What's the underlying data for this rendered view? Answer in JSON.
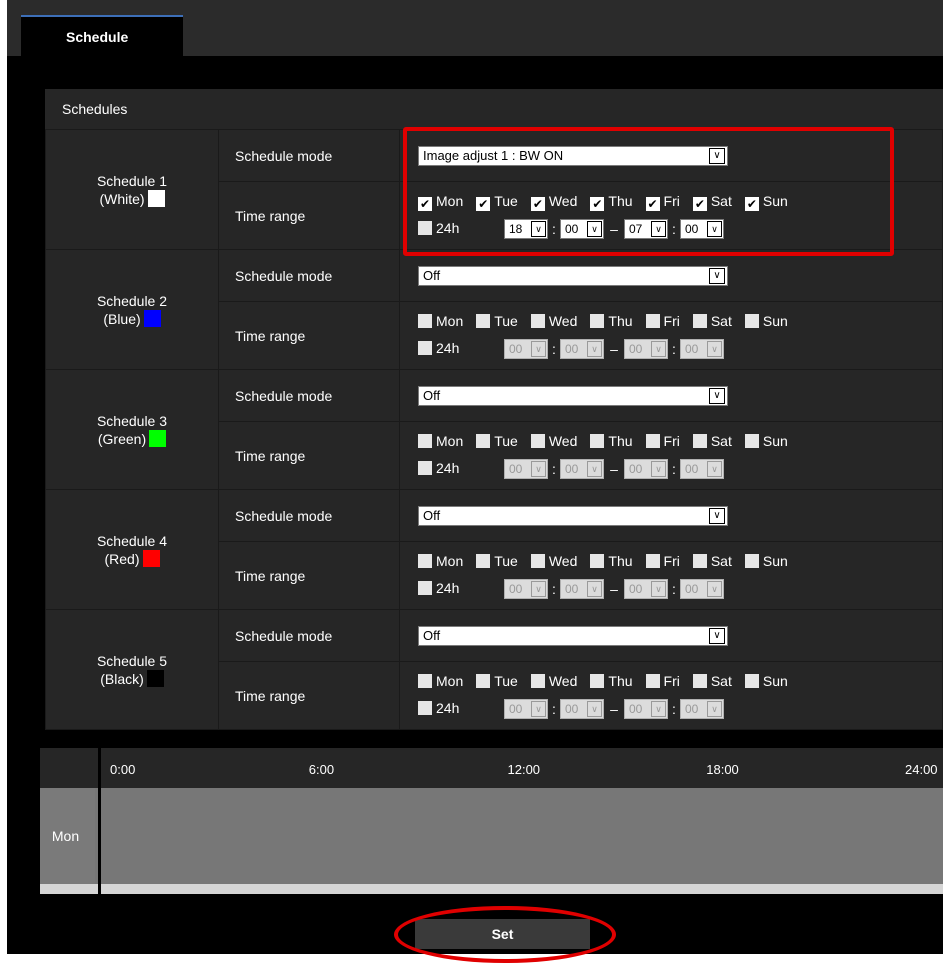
{
  "tab": {
    "label": "Schedule"
  },
  "section_title": "Schedules",
  "row_labels": {
    "mode": "Schedule mode",
    "range": "Time range"
  },
  "day_labels": [
    "Mon",
    "Tue",
    "Wed",
    "Thu",
    "Fri",
    "Sat",
    "Sun"
  ],
  "label_24h": "24h",
  "dash": "–",
  "colon": ":",
  "schedules": [
    {
      "title": "Schedule 1",
      "color_name": "(White)",
      "color": "#ffffff",
      "mode": "Image adjust 1 : BW ON",
      "days_checked": [
        true,
        true,
        true,
        true,
        true,
        true,
        true
      ],
      "all_day": false,
      "start_h": "18",
      "start_m": "00",
      "end_h": "07",
      "end_m": "00",
      "time_enabled": true
    },
    {
      "title": "Schedule 2",
      "color_name": "(Blue)",
      "color": "#0000ff",
      "mode": "Off",
      "days_checked": [
        false,
        false,
        false,
        false,
        false,
        false,
        false
      ],
      "all_day": false,
      "start_h": "00",
      "start_m": "00",
      "end_h": "00",
      "end_m": "00",
      "time_enabled": false
    },
    {
      "title": "Schedule 3",
      "color_name": "(Green)",
      "color": "#00ff00",
      "mode": "Off",
      "days_checked": [
        false,
        false,
        false,
        false,
        false,
        false,
        false
      ],
      "all_day": false,
      "start_h": "00",
      "start_m": "00",
      "end_h": "00",
      "end_m": "00",
      "time_enabled": false
    },
    {
      "title": "Schedule 4",
      "color_name": "(Red)",
      "color": "#ff0000",
      "mode": "Off",
      "days_checked": [
        false,
        false,
        false,
        false,
        false,
        false,
        false
      ],
      "all_day": false,
      "start_h": "00",
      "start_m": "00",
      "end_h": "00",
      "end_m": "00",
      "time_enabled": false
    },
    {
      "title": "Schedule 5",
      "color_name": "(Black)",
      "color": "#000000",
      "mode": "Off",
      "days_checked": [
        false,
        false,
        false,
        false,
        false,
        false,
        false
      ],
      "all_day": false,
      "start_h": "00",
      "start_m": "00",
      "end_h": "00",
      "end_m": "00",
      "time_enabled": false
    }
  ],
  "timeline": {
    "ticks": [
      "0:00",
      "6:00",
      "12:00",
      "18:00",
      "24:00"
    ],
    "day": "Mon"
  },
  "set_button": {
    "label": "Set"
  },
  "colors": {
    "highlight": "#e00000",
    "tab_accent": "#3d6fb8"
  },
  "icons": {
    "checkbox_checked": "checkmark-icon",
    "dropdown": "chevron-down-icon"
  }
}
